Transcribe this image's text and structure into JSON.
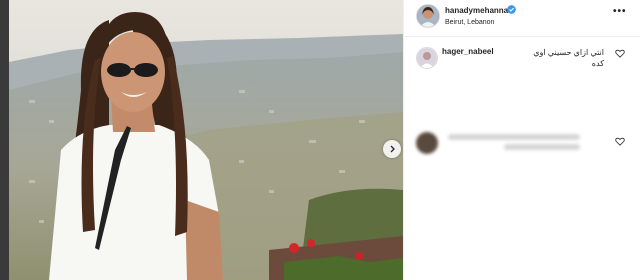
{
  "post": {
    "username": "hanadymehanna",
    "location": "Beirut, Lebanon",
    "verified": true
  },
  "comments": [
    {
      "username": "hager_nabeel",
      "text": "انتي ازاي حسيني اوي كده"
    }
  ],
  "icons": {
    "more": "more-icon",
    "verified": "verified-badge-icon",
    "like": "heart-icon",
    "next": "chevron-right-icon"
  },
  "colors": {
    "verified": "#3897f0",
    "text": "#262626",
    "border": "#efefef"
  }
}
